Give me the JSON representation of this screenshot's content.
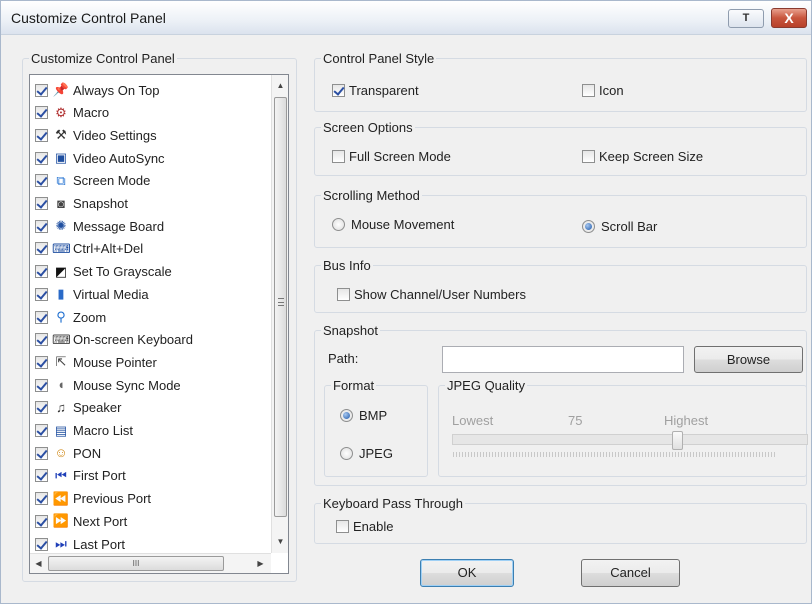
{
  "window": {
    "title": "Customize Control Panel",
    "help_label": "T",
    "close_label": "X"
  },
  "left_panel": {
    "legend": "Customize Control Panel",
    "items": [
      {
        "label": "Always On Top",
        "checked": true,
        "icon": "pin-icon"
      },
      {
        "label": "Macro",
        "checked": true,
        "icon": "macro-icon"
      },
      {
        "label": "Video Settings",
        "checked": true,
        "icon": "hammer-icon"
      },
      {
        "label": "Video AutoSync",
        "checked": true,
        "icon": "monitor-sync-icon"
      },
      {
        "label": "Screen Mode",
        "checked": true,
        "icon": "screen-mode-icon"
      },
      {
        "label": "Snapshot",
        "checked": true,
        "icon": "camera-icon"
      },
      {
        "label": "Message Board",
        "checked": true,
        "icon": "message-board-icon"
      },
      {
        "label": "Ctrl+Alt+Del",
        "checked": true,
        "icon": "ctrl-alt-del-icon"
      },
      {
        "label": "Set To Grayscale",
        "checked": true,
        "icon": "grayscale-icon"
      },
      {
        "label": "Virtual Media",
        "checked": true,
        "icon": "usb-drive-icon"
      },
      {
        "label": "Zoom",
        "checked": true,
        "icon": "magnifier-icon"
      },
      {
        "label": "On-screen Keyboard",
        "checked": true,
        "icon": "keyboard-icon"
      },
      {
        "label": "Mouse Pointer",
        "checked": true,
        "icon": "mouse-pointer-icon"
      },
      {
        "label": "Mouse Sync Mode",
        "checked": true,
        "icon": "mouse-icon"
      },
      {
        "label": "Speaker",
        "checked": true,
        "icon": "speaker-icon"
      },
      {
        "label": "Macro List",
        "checked": true,
        "icon": "macro-list-icon"
      },
      {
        "label": "PON",
        "checked": true,
        "icon": "pon-icon"
      },
      {
        "label": "First Port",
        "checked": true,
        "icon": "first-port-icon"
      },
      {
        "label": "Previous Port",
        "checked": true,
        "icon": "previous-port-icon"
      },
      {
        "label": "Next Port",
        "checked": true,
        "icon": "next-port-icon"
      },
      {
        "label": "Last Port",
        "checked": true,
        "icon": "last-port-icon"
      }
    ],
    "hscroll_grip": "III"
  },
  "style_group": {
    "legend": "Control Panel Style",
    "transparent": {
      "label": "Transparent",
      "checked": true
    },
    "icon": {
      "label": "Icon",
      "checked": false
    }
  },
  "screen_group": {
    "legend": "Screen Options",
    "full_screen": {
      "label": "Full Screen Mode",
      "checked": false
    },
    "keep_size": {
      "label": "Keep Screen Size",
      "checked": false
    }
  },
  "scroll_group": {
    "legend": "Scrolling Method",
    "mouse_movement": {
      "label": "Mouse Movement",
      "selected": false
    },
    "scroll_bar": {
      "label": "Scroll Bar",
      "selected": true
    }
  },
  "bus_group": {
    "legend": "Bus Info",
    "show_numbers": {
      "label": "Show Channel/User Numbers",
      "checked": false
    }
  },
  "snapshot_group": {
    "legend": "Snapshot",
    "path_label": "Path:",
    "path_value": "",
    "browse_label": "Browse",
    "format": {
      "legend": "Format",
      "bmp": "BMP",
      "jpeg": "JPEG",
      "selected": "BMP"
    },
    "quality": {
      "legend": "JPEG Quality",
      "lowest": "Lowest",
      "value_text": "75",
      "highest": "Highest",
      "value": 75,
      "min": 0,
      "max": 100,
      "enabled": false
    }
  },
  "keyboard_group": {
    "legend": "Keyboard Pass Through",
    "enable": {
      "label": "Enable",
      "checked": false
    }
  },
  "footer": {
    "ok_label": "OK",
    "cancel_label": "Cancel"
  },
  "colors": {
    "accent": "#1c57a8",
    "close_button": "#c8553d",
    "disabled_text": "#a0a0a0"
  }
}
